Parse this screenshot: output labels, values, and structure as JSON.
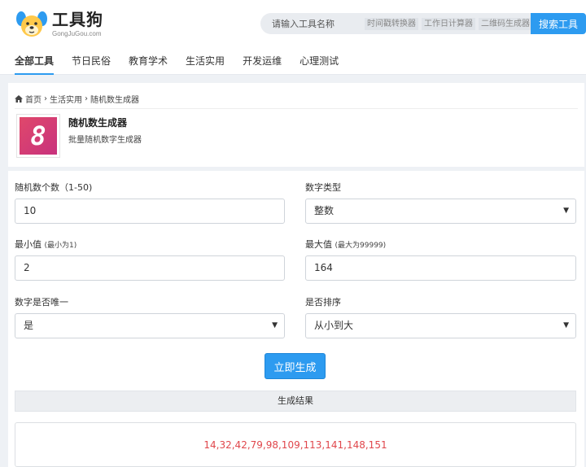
{
  "brand": {
    "title": "工具狗",
    "subtitle": "GongJuGou.com"
  },
  "search": {
    "placeholder": "请输入工具名称",
    "tags": [
      "时间戳转换器",
      "工作日计算器",
      "二维码生成器"
    ],
    "button_label": "搜索工具"
  },
  "nav": {
    "items": [
      "全部工具",
      "节日民俗",
      "教育学术",
      "生活实用",
      "开发运维",
      "心理测试"
    ],
    "active_index": 0
  },
  "breadcrumb": {
    "items": [
      "首页",
      "生活实用",
      "随机数生成器"
    ],
    "separator": "›"
  },
  "tool": {
    "icon_glyph": "8",
    "name": "随机数生成器",
    "description": "批量随机数字生成器"
  },
  "form": {
    "count": {
      "label": "随机数个数（1-50)",
      "value": "10"
    },
    "type": {
      "label": "数字类型",
      "value": "整数"
    },
    "min": {
      "label": "最小值",
      "hint": "(最小为1)",
      "value": "2"
    },
    "max": {
      "label": "最大值",
      "hint": "(最大为99999)",
      "value": "164"
    },
    "unique": {
      "label": "数字是否唯一",
      "value": "是"
    },
    "sort": {
      "label": "是否排序",
      "value": "从小到大"
    },
    "generate_label": "立即生成"
  },
  "result": {
    "header": "生成结果",
    "values": "14,32,42,79,98,109,113,141,148,151"
  },
  "colors": {
    "accent": "#2d9bf0",
    "result_text": "#e0474c",
    "tool_icon": "#d83e74"
  },
  "icons": {
    "home": "home-icon",
    "select": "caret-down-icon"
  }
}
